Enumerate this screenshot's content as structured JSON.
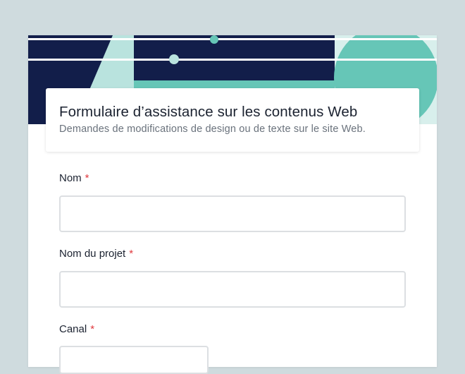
{
  "form": {
    "title": "Formulaire d’assistance sur les contenus Web",
    "subtitle": "Demandes de modifications de design ou de texte sur le site Web.",
    "required_marker": "*"
  },
  "fields": [
    {
      "label": "Nom",
      "value": "",
      "placeholder": ""
    },
    {
      "label": "Nom du projet",
      "value": "",
      "placeholder": ""
    },
    {
      "label": "Canal",
      "value": ""
    }
  ],
  "colors": {
    "banner_navy": "#121e4a",
    "banner_teal": "#66c6b7",
    "banner_light_teal": "#b9e3de",
    "required": "#e0393e",
    "background": "#cfdbde"
  }
}
